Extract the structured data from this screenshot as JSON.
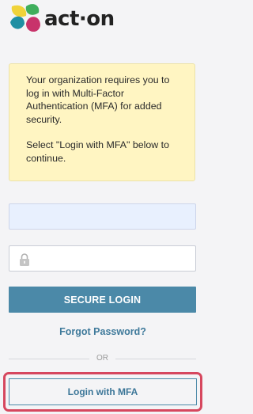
{
  "brand": {
    "name": "act·on",
    "colors": {
      "yellow": "#f0d33a",
      "green": "#3fae5c",
      "teal": "#1f8fa3",
      "magenta": "#c8336b"
    }
  },
  "notice": {
    "line1": "Your organization requires you to log in with Multi-Factor Authentication (MFA) for added security.",
    "line2": "Select \"Login with MFA\" below to continue."
  },
  "login_form": {
    "username_value": "",
    "password_value": "",
    "password_icon": "lock-icon",
    "submit_label": "SECURE LOGIN",
    "forgot_label": "Forgot Password?",
    "divider_label": "OR",
    "mfa_label": "Login with MFA"
  },
  "colors": {
    "accent": "#4b89a8",
    "link": "#3f7a9b",
    "notice_bg": "#fff5c2",
    "highlight": "#d6475e",
    "autofill_bg": "#e8f0fe"
  }
}
